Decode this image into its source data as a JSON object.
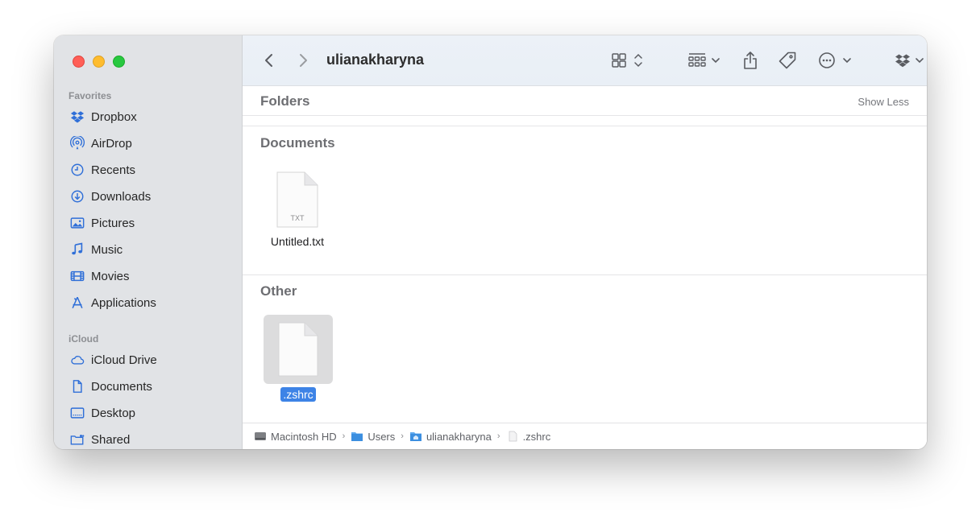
{
  "window": {
    "title": "ulianakharyna"
  },
  "sidebar": {
    "favorites_label": "Favorites",
    "favorites": [
      {
        "label": "Dropbox",
        "icon": "dropbox-icon"
      },
      {
        "label": "AirDrop",
        "icon": "airdrop-icon"
      },
      {
        "label": "Recents",
        "icon": "clock-icon"
      },
      {
        "label": "Downloads",
        "icon": "download-icon"
      },
      {
        "label": "Pictures",
        "icon": "photo-icon"
      },
      {
        "label": "Music",
        "icon": "music-note-icon"
      },
      {
        "label": "Movies",
        "icon": "film-icon"
      },
      {
        "label": "Applications",
        "icon": "applications-icon"
      }
    ],
    "icloud_label": "iCloud",
    "icloud": [
      {
        "label": "iCloud Drive",
        "icon": "cloud-icon"
      },
      {
        "label": "Documents",
        "icon": "document-icon"
      },
      {
        "label": "Desktop",
        "icon": "desktop-icon"
      },
      {
        "label": "Shared",
        "icon": "shared-folder-icon"
      }
    ]
  },
  "groups": {
    "folders": {
      "title": "Folders",
      "toggle": "Show Less"
    },
    "documents": {
      "title": "Documents",
      "files": [
        {
          "name": "Untitled.txt",
          "badge": "TXT"
        }
      ]
    },
    "other": {
      "title": "Other",
      "files": [
        {
          "name": ".zshrc",
          "selected": true
        }
      ]
    }
  },
  "pathbar": {
    "items": [
      "Macintosh HD",
      "Users",
      "ulianakharyna",
      ".zshrc"
    ]
  },
  "colors": {
    "accent": "#3d83e6",
    "sidebar": "#e1e3e6",
    "toolbar": "#ecf1f7"
  }
}
